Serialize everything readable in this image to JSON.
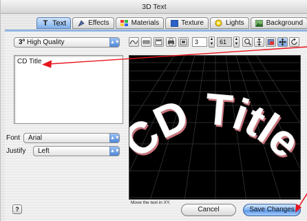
{
  "window": {
    "title": "3D Text"
  },
  "tabs": [
    {
      "label": "Text",
      "icon": "T"
    },
    {
      "label": "Effects",
      "icon": "effects-icon"
    },
    {
      "label": "Materials",
      "icon": "materials-icon"
    },
    {
      "label": "Texture",
      "icon": "texture-icon"
    },
    {
      "label": "Lights",
      "icon": "lights-icon"
    },
    {
      "label": "Background",
      "icon": "background-icon"
    }
  ],
  "quality": {
    "prefix": "3º",
    "value": "High Quality"
  },
  "toolbar": {
    "field_1": "3",
    "field_2": "61"
  },
  "text_input": {
    "value": "CD Title"
  },
  "font": {
    "label": "Font",
    "value": "Arial"
  },
  "justify": {
    "label": "Justify",
    "value": "Left"
  },
  "preview": {
    "text": "CD Title",
    "status": "Move the text in XY."
  },
  "buttons": {
    "cancel": "Cancel",
    "save": "Save Changes",
    "help": "?"
  },
  "colors": {
    "accent": "#5a98ea",
    "annotation": "#e8141e"
  }
}
